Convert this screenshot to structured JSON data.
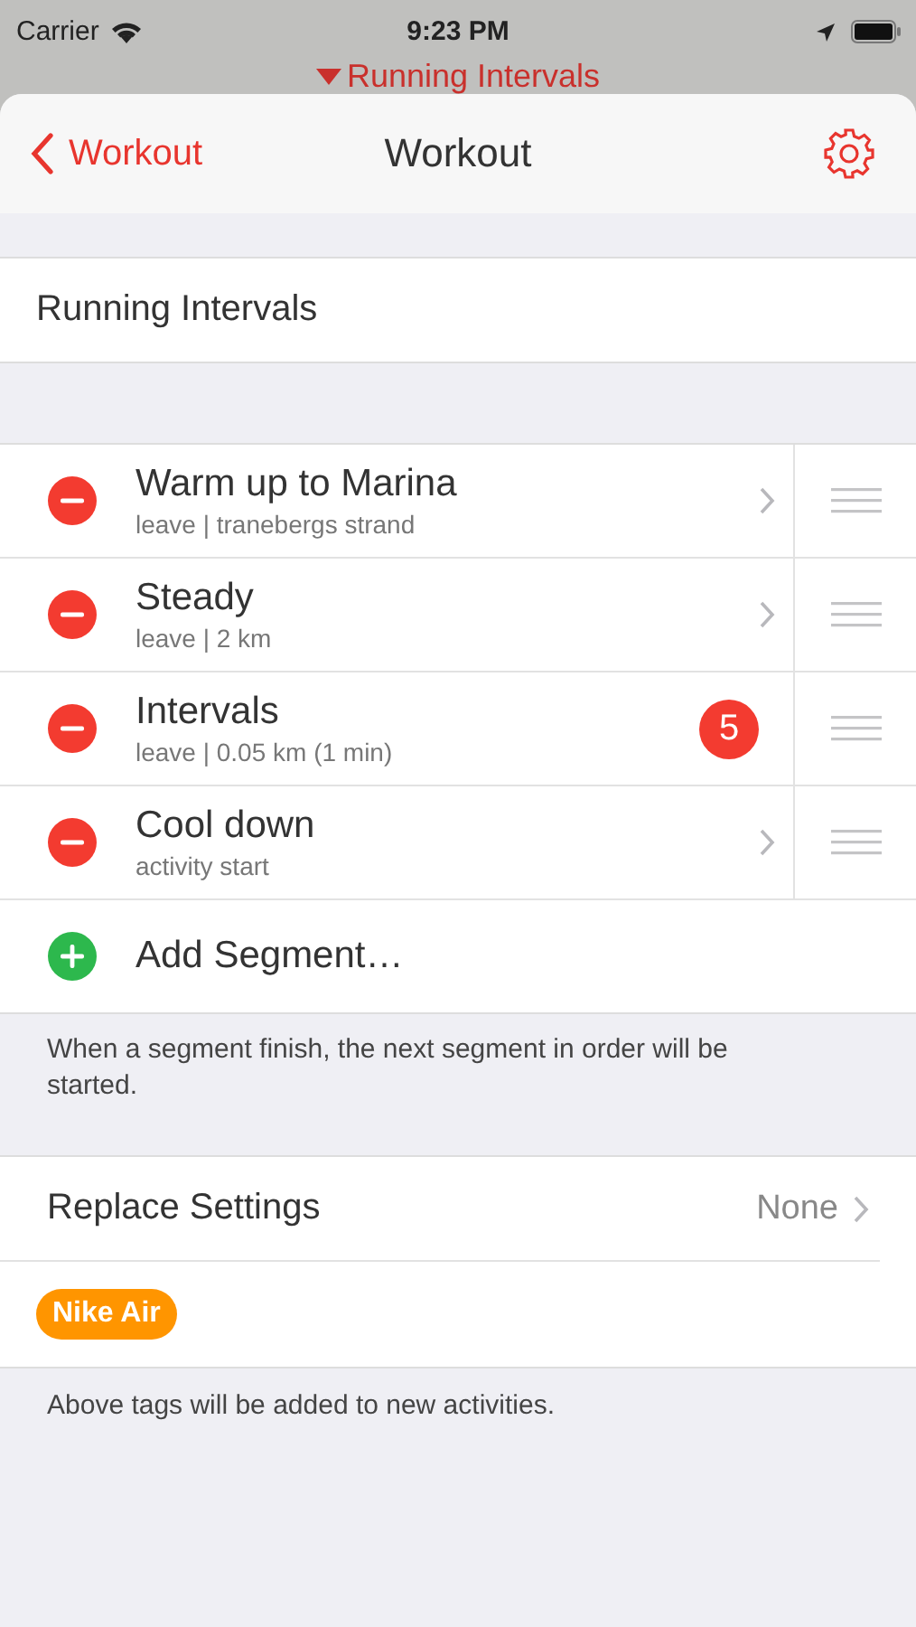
{
  "status_bar": {
    "carrier": "Carrier",
    "time": "9:23 PM"
  },
  "behind": {
    "title": "Running Intervals"
  },
  "nav": {
    "back": "Workout",
    "title": "Workout"
  },
  "workout_name": "Running Intervals",
  "segments": [
    {
      "title": "Warm up to Marina",
      "subtitle": "leave | tranebergs strand"
    },
    {
      "title": "Steady",
      "subtitle": "leave | 2 km"
    },
    {
      "title": "Intervals",
      "subtitle": "leave | 0.05 km (1 min)",
      "badge": "5"
    },
    {
      "title": "Cool down",
      "subtitle": "activity start"
    }
  ],
  "add_segment": "Add Segment…",
  "segments_footer": "When a segment finish, the next segment in order will be started.",
  "replace_settings": {
    "label": "Replace Settings",
    "value": "None"
  },
  "tags": [
    {
      "label": "Nike Air",
      "color": "#ff9500"
    }
  ],
  "tags_footer": "Above tags will be added to new activities."
}
